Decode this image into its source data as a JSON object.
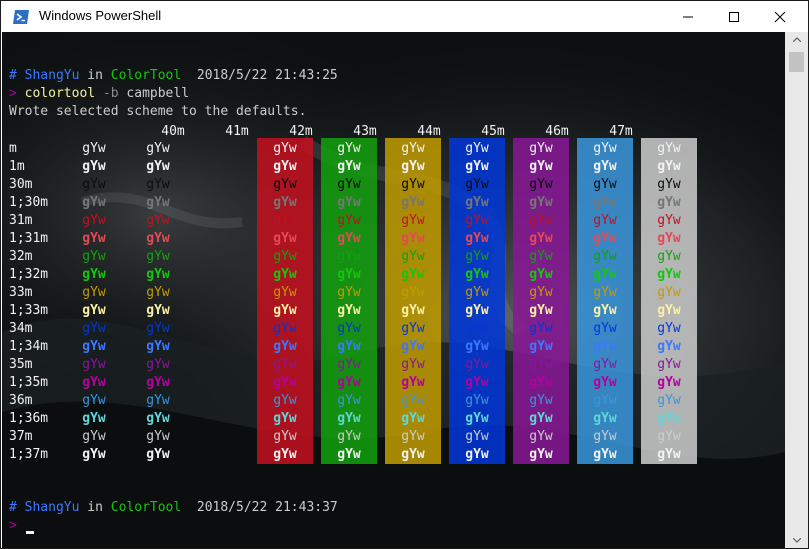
{
  "window": {
    "title": "Windows PowerShell",
    "controls": [
      "minimize",
      "maximize",
      "close"
    ]
  },
  "terminal": {
    "prompt1": {
      "hash": "#",
      "user": "ShangYu",
      "in": "in",
      "dir": "ColorTool",
      "datetime": "2018/5/22 21:43:25"
    },
    "command": {
      "arrow": ">",
      "cmd": "colortool",
      "flag": "-b",
      "arg": "campbell"
    },
    "output": "Wrote selected scheme to the defaults.",
    "prompt2": {
      "hash": "#",
      "user": "ShangYu",
      "in": "in",
      "dir": "ColorTool",
      "datetime": "2018/5/22 21:43:37"
    },
    "prompt3_arrow": ">"
  },
  "colors": {
    "fg": {
      "m": "#cccccc",
      "1m": "#f2f2f2",
      "30m": "#0c0c0c",
      "1;30m": "#767676",
      "31m": "#c50f1f",
      "1;31m": "#e74856",
      "32m": "#13a10e",
      "1;32m": "#16c60c",
      "33m": "#c19c00",
      "1;33m": "#f9f1a5",
      "34m": "#0037da",
      "1;34m": "#3b78ff",
      "35m": "#881798",
      "1;35m": "#b4009e",
      "36m": "#3a96dd",
      "1;36m": "#61d6d6",
      "37m": "#cccccc",
      "1;37m": "#f2f2f2"
    },
    "bg": {
      "40m": "transparent",
      "41m": "#c50f1f",
      "42m": "#13a10e",
      "43m": "#c19c00",
      "44m": "#0037da",
      "45m": "#881798",
      "46m": "#3a96dd",
      "47m": "#cccccc"
    }
  },
  "color_table": {
    "sample": "gYw",
    "columns": [
      "40m",
      "41m",
      "42m",
      "43m",
      "44m",
      "45m",
      "46m",
      "47m"
    ],
    "rows": [
      "m",
      "1m",
      "30m",
      "1;30m",
      "31m",
      "1;31m",
      "32m",
      "1;32m",
      "33m",
      "1;33m",
      "34m",
      "1;34m",
      "35m",
      "1;35m",
      "36m",
      "1;36m",
      "37m",
      "1;37m"
    ]
  }
}
